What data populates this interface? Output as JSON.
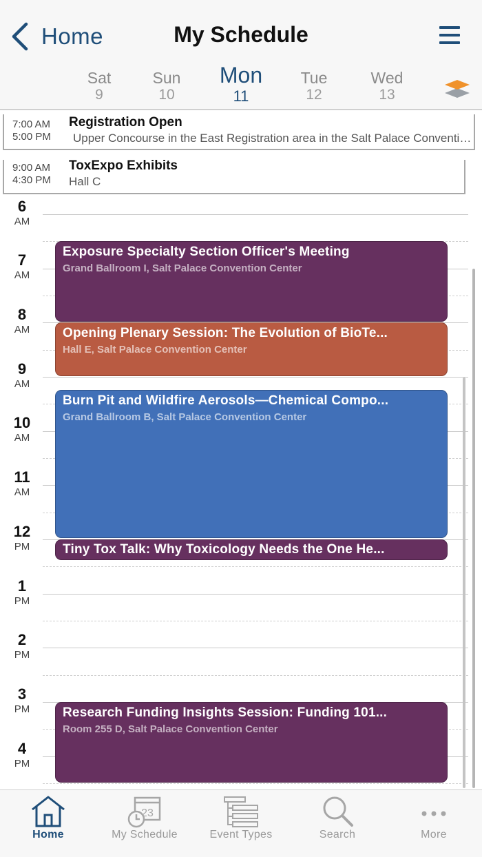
{
  "header": {
    "back_label": "Home",
    "title": "My Schedule"
  },
  "days": [
    {
      "name": "Sat",
      "num": "9"
    },
    {
      "name": "Sun",
      "num": "10"
    },
    {
      "name": "Mon",
      "num": "11"
    },
    {
      "name": "Tue",
      "num": "12"
    },
    {
      "name": "Wed",
      "num": "13"
    }
  ],
  "all_day": [
    {
      "start": "7:00 AM",
      "end": "5:00 PM",
      "title": "Registration Open",
      "location": "Upper Concourse in the East Registration area in the Salt Palace Convention Center"
    },
    {
      "start": "9:00 AM",
      "end": "4:30 PM",
      "title": "ToxExpo Exhibits",
      "location": "Hall C"
    }
  ],
  "hours": [
    {
      "h": "6",
      "ap": "AM"
    },
    {
      "h": "7",
      "ap": "AM"
    },
    {
      "h": "8",
      "ap": "AM"
    },
    {
      "h": "9",
      "ap": "AM"
    },
    {
      "h": "10",
      "ap": "AM"
    },
    {
      "h": "11",
      "ap": "AM"
    },
    {
      "h": "12",
      "ap": "PM"
    },
    {
      "h": "1",
      "ap": "PM"
    },
    {
      "h": "2",
      "ap": "PM"
    },
    {
      "h": "3",
      "ap": "PM"
    },
    {
      "h": "4",
      "ap": "PM"
    }
  ],
  "events": [
    {
      "title": "Exposure Specialty Section Officer's Meeting",
      "location": "Grand Ballroom I, Salt Palace Convention Center",
      "color": "#66305f"
    },
    {
      "title": "Opening Plenary Session: The Evolution of BioTe...",
      "location": "Hall E, Salt Palace Convention Center",
      "color": "#b95b42"
    },
    {
      "title": "Burn Pit and Wildfire Aerosols—Chemical Compo...",
      "location": "Grand Ballroom B, Salt Palace Convention Center",
      "color": "#4170b8"
    },
    {
      "title": "Tiny Tox Talk: Why Toxicology Needs the One He...",
      "location": "",
      "color": "#66305f"
    },
    {
      "title": "Research Funding Insights Session: Funding 101...",
      "location": "Room 255 D, Salt Palace Convention Center",
      "color": "#66305f"
    }
  ],
  "tabs": [
    {
      "label": "Home",
      "icon": "home-icon"
    },
    {
      "label": "My Schedule",
      "icon": "calendar-clock-icon",
      "calendar_day": "23"
    },
    {
      "label": "Event Types",
      "icon": "list-tree-icon"
    },
    {
      "label": "Search",
      "icon": "search-icon"
    },
    {
      "label": "More",
      "icon": "more-dots-icon"
    }
  ],
  "colors": {
    "accent": "#1f4e79",
    "layers_top": "#f0922b",
    "layers_bottom": "#9aa0a6"
  }
}
